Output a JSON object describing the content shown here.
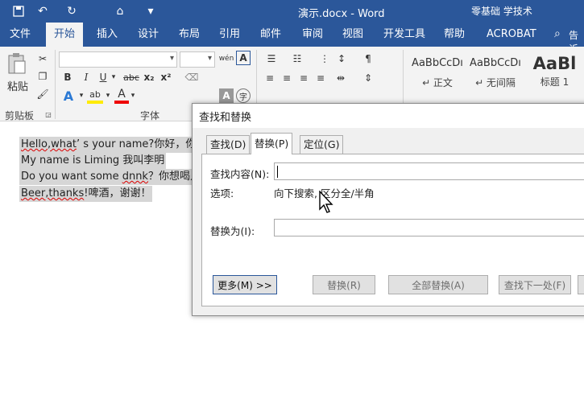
{
  "titlebar": {
    "doc_title": "演示.docx  -  Word",
    "user": "零基础 学技术",
    "qa_icons": [
      "save-icon",
      "undo-icon",
      "redo-icon",
      "format-painter-icon",
      "customize-icon"
    ]
  },
  "tabs": [
    "文件",
    "开始",
    "插入",
    "设计",
    "布局",
    "引用",
    "邮件",
    "审阅",
    "视图",
    "开发工具",
    "帮助",
    "ACROBAT"
  ],
  "tell_me": "告诉",
  "ribbon": {
    "clipboard": {
      "paste": "粘贴",
      "group": "剪贴板"
    },
    "font": {
      "group": "字体",
      "bold": "B",
      "italic": "I",
      "underline": "U",
      "strike": "abc",
      "sub": "x₂",
      "sup": "x²",
      "phonetic": "wén",
      "border_char": "A",
      "text_effect": "A",
      "highlight": "ab",
      "font_color": "A",
      "shade": "A",
      "circle": "字"
    },
    "styles": [
      {
        "preview": "AaBbCcDı",
        "name": "↵ 正文"
      },
      {
        "preview": "AaBbCcDı",
        "name": "↵ 无间隔"
      },
      {
        "preview": "AaBl",
        "name": "标题 1"
      }
    ]
  },
  "document": {
    "lines": [
      {
        "pre": "",
        "squig": "Hello,what",
        "rest": "’  s your name?你好，你"
      },
      {
        "pre": "My name is Liming 我叫李明",
        "squig": "",
        "rest": ""
      },
      {
        "pre": "Do you want some ",
        "squig": "dnnk",
        "rest": "？你想喝点"
      },
      {
        "pre": "",
        "squig": "Beer,thanks",
        "rest": "!啤酒，谢谢！"
      }
    ]
  },
  "dialog": {
    "title": "查找和替换",
    "tabs": [
      "查找(D)",
      "替换(P)",
      "定位(G)"
    ],
    "active_tab": "替换(P)",
    "find_label": "查找内容(N):",
    "find_value": "",
    "options_label": "选项:",
    "options_value": "向下搜索, 区分全/半角",
    "replace_label": "替换为(I):",
    "replace_value": "",
    "buttons": {
      "more": "更多(M) >>",
      "replace": "替换(R)",
      "replace_all": "全部替换(A)",
      "find_next": "查找下一处(F)"
    }
  }
}
